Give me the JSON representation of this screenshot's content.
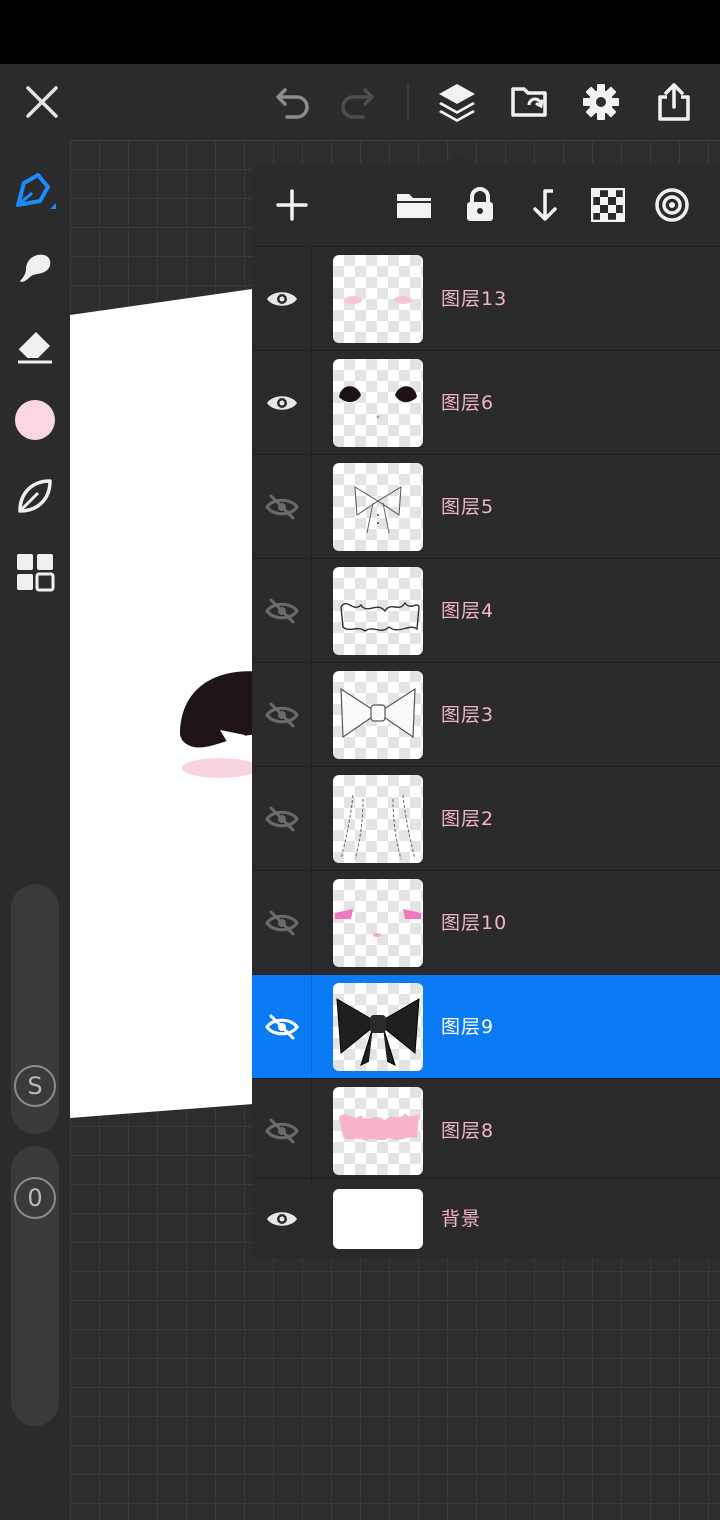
{
  "toolbar": {
    "close_icon": "close-icon",
    "undo_icon": "undo-icon",
    "redo_icon": "redo-icon",
    "layers_icon": "layers-icon",
    "gallery_icon": "gallery-import-icon",
    "settings_icon": "gear-icon",
    "share_icon": "share-icon"
  },
  "left_tools": {
    "items": [
      "pen-tool",
      "smudge-tool",
      "eraser-tool",
      "color-swatch",
      "leaf-shape-tool",
      "grid-menu"
    ],
    "current_color": "#fcd6e3",
    "accent": "#1a8cff",
    "size_label": "S",
    "opacity_label": "0"
  },
  "layers_panel": {
    "tools": [
      "add-layer",
      "folder",
      "lock",
      "merge-down",
      "transparency-lock",
      "clipping-mask"
    ],
    "layers": [
      {
        "name": "图层13",
        "visible": true,
        "selected": false
      },
      {
        "name": "图层6",
        "visible": true,
        "selected": false
      },
      {
        "name": "图层5",
        "visible": false,
        "selected": false
      },
      {
        "name": "图层4",
        "visible": false,
        "selected": false
      },
      {
        "name": "图层3",
        "visible": false,
        "selected": false
      },
      {
        "name": "图层2",
        "visible": false,
        "selected": false
      },
      {
        "name": "图层10",
        "visible": false,
        "selected": false
      },
      {
        "name": "图层9",
        "visible": false,
        "selected": true
      },
      {
        "name": "图层8",
        "visible": false,
        "selected": false
      }
    ],
    "background": {
      "name": "背景",
      "visible": true
    }
  }
}
